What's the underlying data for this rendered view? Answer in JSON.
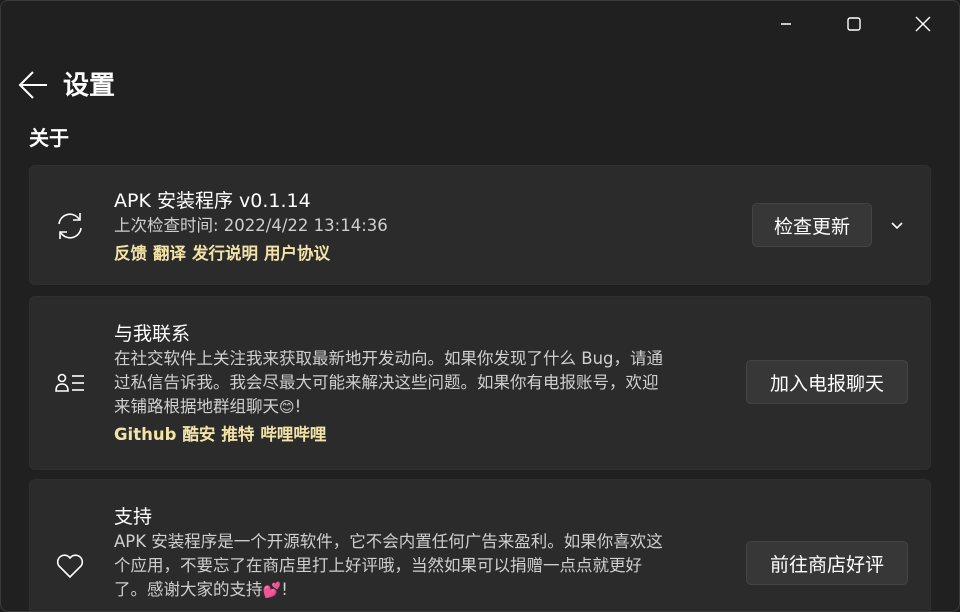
{
  "window": {
    "controls": {
      "minimize_icon": "minimize-icon",
      "maximize_icon": "maximize-icon",
      "close_icon": "close-icon"
    }
  },
  "header": {
    "back_icon": "back-arrow-icon",
    "title": "设置"
  },
  "section": {
    "title": "关于"
  },
  "about": {
    "icon": "sync-icon",
    "title": "APK 安装程序 v0.1.14",
    "last_check": "上次检查时间: 2022/4/22 13:14:36",
    "links": [
      "反馈",
      "翻译",
      "发行说明",
      "用户协议"
    ],
    "button": "检查更新",
    "chevron_icon": "chevron-down-icon"
  },
  "contact": {
    "icon": "contact-list-icon",
    "title": "与我联系",
    "desc_line1": "在社交软件上关注我来获取最新地开发动向。如果你发现了什么 Bug，请通",
    "desc_line2": "过私信告诉我。我会尽最大可能来解决这些问题。如果你有电报账号，欢迎",
    "desc_line3": "来铺路根据地群组聊天",
    "desc_emoji": "😊",
    "desc_end": "!",
    "links": [
      "Github",
      "酷安",
      "推特",
      "哔哩哔哩"
    ],
    "button": "加入电报聊天"
  },
  "support": {
    "icon": "heart-icon",
    "title": "支持",
    "desc_line1": "APK 安装程序是一个开源软件，它不会内置任何广告来盈利。如果你喜欢这",
    "desc_line2": "个应用，不要忘了在商店里打上好评哦，当然如果可以捐赠一点点就更好",
    "desc_line3": "了。感谢大家的支持",
    "desc_emoji": "💕",
    "desc_end": "!",
    "button": "前往商店好评"
  },
  "colors": {
    "background": "#202020",
    "card": "#2b2b2b",
    "link": "#f2e3a8",
    "button": "#373737"
  }
}
